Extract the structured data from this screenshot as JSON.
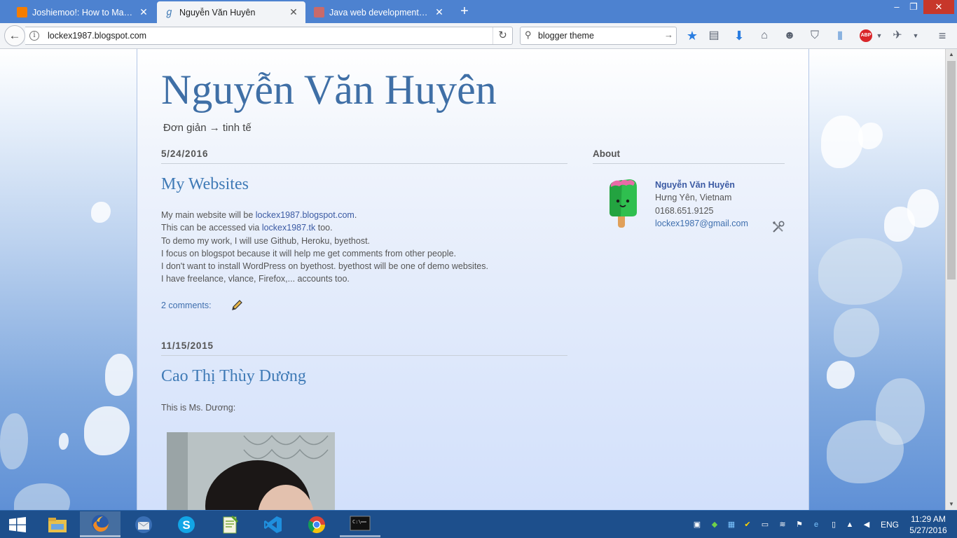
{
  "browser": {
    "tabs": [
      {
        "label": "Joshiemoo!: How to Make...",
        "icon": "blogger-icon",
        "active": false
      },
      {
        "label": "Nguyễn Văn Huyên",
        "icon": "page-icon",
        "active": true
      },
      {
        "label": "Java web development tut...",
        "icon": "stack-icon",
        "active": false
      }
    ],
    "new_tab": "+",
    "url": "lockex1987.blogspot.com",
    "search_value": "blogger theme",
    "abp_label": "ABP"
  },
  "blog": {
    "title": "Nguyễn Văn Huyên",
    "description": "Đơn giản → tinh tế",
    "posts": [
      {
        "date": "5/24/2016",
        "title": "My Websites",
        "lines": [
          {
            "pre": "My main website will be ",
            "link": "lockex1987.blogspot.com",
            "post": "."
          },
          {
            "pre": "This can be accessed via ",
            "link": "lockex1987.tk",
            "post": " too."
          },
          {
            "text": "To demo my work, I will use Github, Heroku, byethost."
          },
          {
            "text": "I focus on blogspot because it will help me get comments from other people."
          },
          {
            "text": "I don't want to install WordPress on byethost. byethost will be one of demo websites."
          },
          {
            "text": "I have freelance, vlance, Firefox,... accounts too."
          }
        ],
        "comments": "2 comments:"
      },
      {
        "date": "11/15/2015",
        "title": "Cao Thị Thùy Dương",
        "body": "This is Ms. Dương:"
      }
    ]
  },
  "sidebar": {
    "title": "About",
    "name": "Nguyễn Văn Huyên",
    "location": "Hưng Yên, Vietnam",
    "phone": "0168.651.9125",
    "email": "lockex1987@gmail.com"
  },
  "taskbar": {
    "apps": [
      "file-explorer-icon",
      "firefox-icon",
      "thunderbird-icon",
      "skype-icon",
      "notepad-plus-plus-icon",
      "visual-studio-icon",
      "chrome-icon",
      "terminal-icon"
    ],
    "language": "ENG",
    "time": "11:29 AM",
    "date": "5/27/2016"
  },
  "colors": {
    "title": "#3f6fa6",
    "link": "#3b5aa3",
    "tabbar": "#4d82d0",
    "taskbar": "#1d4f8c"
  }
}
